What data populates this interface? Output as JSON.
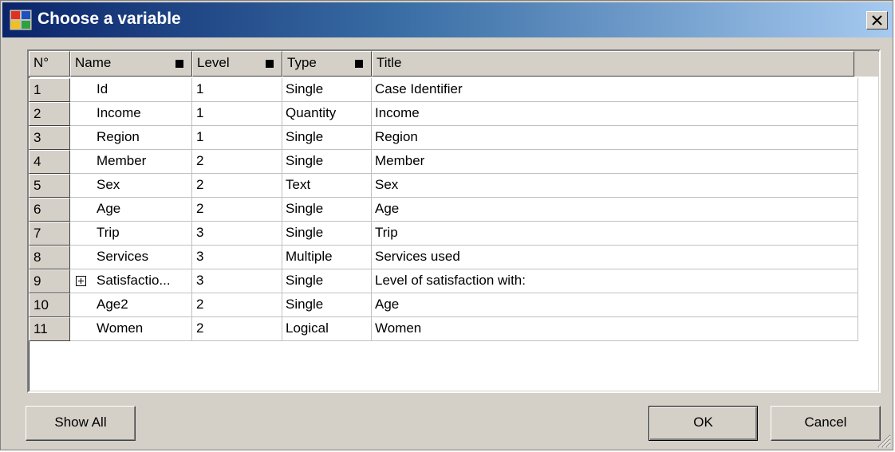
{
  "window": {
    "title": "Choose a variable",
    "close_glyph": "close-icon"
  },
  "grid": {
    "columns": [
      "N°",
      "Name",
      "Level",
      "Type",
      "Title"
    ],
    "rows": [
      {
        "n": "1",
        "name": "Id",
        "level": "1",
        "type": "Single",
        "title": "Case Identifier"
      },
      {
        "n": "2",
        "name": "Income",
        "level": "1",
        "type": "Quantity",
        "title": "Income"
      },
      {
        "n": "3",
        "name": "Region",
        "level": "1",
        "type": "Single",
        "title": "Region"
      },
      {
        "n": "4",
        "name": "Member",
        "level": "2",
        "type": "Single",
        "title": "Member"
      },
      {
        "n": "5",
        "name": "Sex",
        "level": "2",
        "type": "Text",
        "title": "Sex"
      },
      {
        "n": "6",
        "name": "Age",
        "level": "2",
        "type": "Single",
        "title": "Age"
      },
      {
        "n": "7",
        "name": "Trip",
        "level": "3",
        "type": "Single",
        "title": "Trip"
      },
      {
        "n": "8",
        "name": "Services",
        "level": "3",
        "type": "Multiple",
        "title": "Services used"
      },
      {
        "n": "9",
        "name": "Satisfactio...",
        "level": "3",
        "type": "Single",
        "title": "Level of satisfaction with:",
        "expandable": true
      },
      {
        "n": "10",
        "name": "Age2",
        "level": "2",
        "type": "Single",
        "title": "Age"
      },
      {
        "n": "11",
        "name": "Women",
        "level": "2",
        "type": "Logical",
        "title": "Women"
      }
    ]
  },
  "buttons": {
    "show_all": "Show All",
    "ok": "OK",
    "cancel": "Cancel"
  },
  "colors": {
    "face": "#d4d0c8",
    "title_start": "#0a246a",
    "title_end": "#a6caf0"
  }
}
